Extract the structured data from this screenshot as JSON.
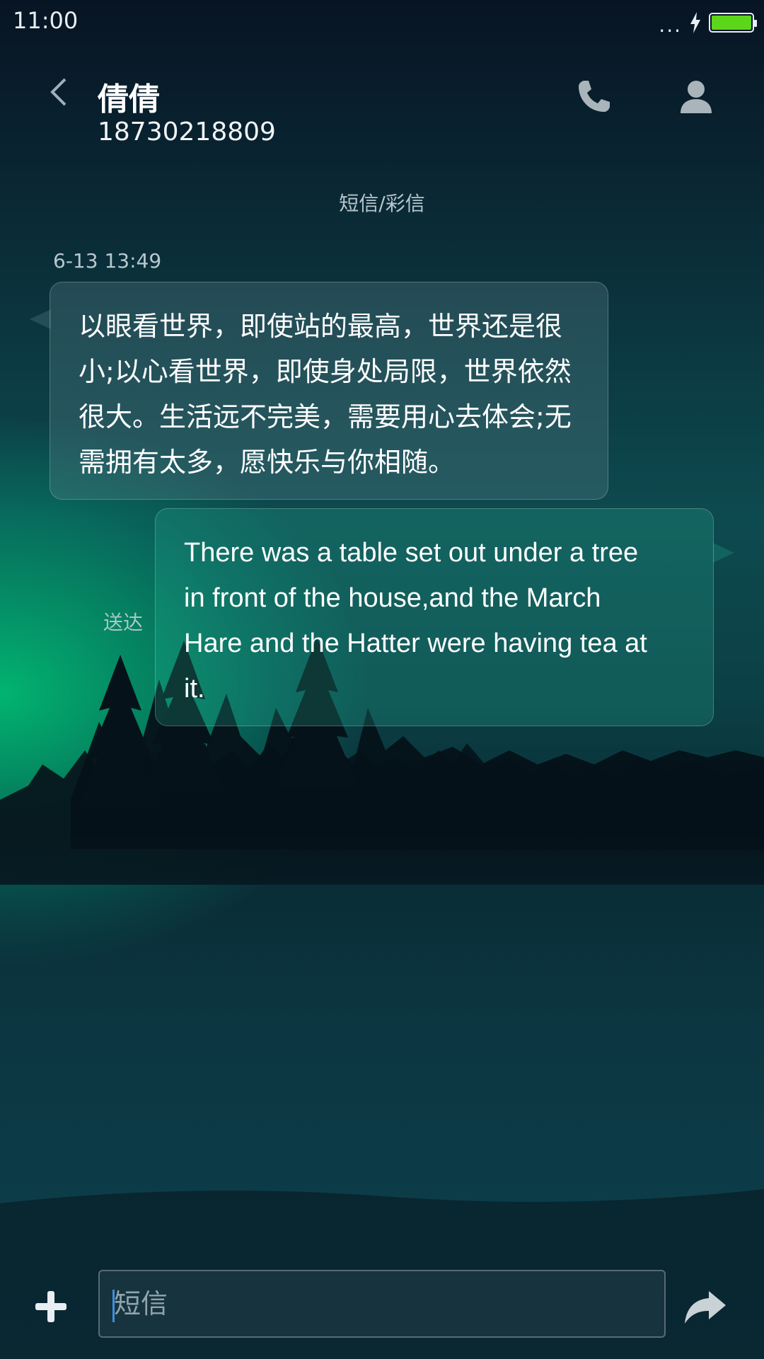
{
  "status_bar": {
    "time": "11:00",
    "signal_dots": "...",
    "battery_level": 1.0,
    "battery_color": "#5cd61a"
  },
  "header": {
    "contact_name": "倩倩",
    "contact_number": "18730218809",
    "icons": {
      "back": "chevron-left-icon",
      "call": "phone-icon",
      "contact": "person-icon"
    }
  },
  "conversation": {
    "channel_label": "短信/彩信",
    "timestamp": "6-13 13:49",
    "messages": [
      {
        "direction": "incoming",
        "lines": [
          "以眼看世界，即使站的最高，世界还是很",
          "小;以心看世界，即使身处局限，世界依然",
          "很大。生活远不完美，需要用心去体会;无",
          "需拥有太多，愿快乐与你相随。"
        ]
      },
      {
        "direction": "outgoing",
        "status": "送达",
        "lines": [
          "There was a table set out under a tree",
          "in front of the house,and the March",
          "Hare and the Hatter were having tea at",
          "it."
        ]
      }
    ]
  },
  "composer": {
    "placeholder": "短信",
    "value": "",
    "caret_color": "#3a8fe0",
    "icons": {
      "add": "plus-icon",
      "send": "send-arrow-icon"
    }
  }
}
